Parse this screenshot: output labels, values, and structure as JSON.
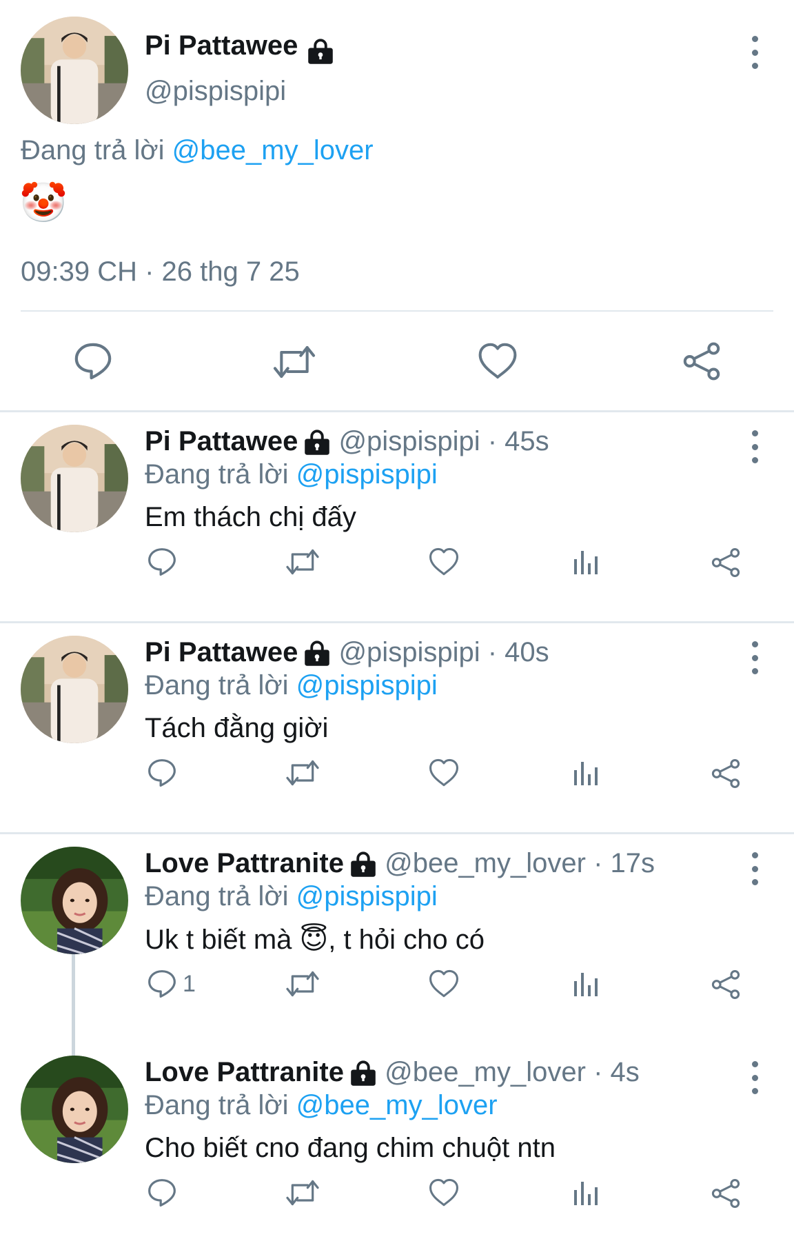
{
  "main_tweet": {
    "name": "Pi Pattawee",
    "handle": "@pispispipi",
    "replying_prefix": "Đang trả lời",
    "replying_to": "@bee_my_lover",
    "emoji": "🤡",
    "timestamp": "09:39 CH · 26 thg 7 25"
  },
  "replies": [
    {
      "name": "Pi Pattawee",
      "meta": "@pispispipi · 45s",
      "replying_prefix": "Đang trả lời",
      "replying_to": "@pispispipi",
      "text": "Em thách chị đấy",
      "reply_count": ""
    },
    {
      "name": "Pi Pattawee",
      "meta": "@pispispipi · 40s",
      "replying_prefix": "Đang trả lời",
      "replying_to": "@pispispipi",
      "text": "Tách đằng giời",
      "reply_count": ""
    },
    {
      "name": "Love Pattranite",
      "meta": "@bee_my_lover · 17s",
      "replying_prefix": "Đang trả lời",
      "replying_to": "@pispispipi",
      "text_before": "Uk t biết mà ",
      "emoji": "😇",
      "text_after": ", t hỏi cho có",
      "reply_count": "1"
    },
    {
      "name": "Love Pattranite",
      "meta": "@bee_my_lover · 4s",
      "replying_prefix": "Đang trả lời",
      "replying_to": "@bee_my_lover",
      "text": "Cho biết cno đang chim chuột ntn",
      "reply_count": ""
    }
  ],
  "colors": {
    "accent": "#1da1f2",
    "muted": "#657786",
    "divider": "#e1e8ed"
  },
  "icons": [
    "lock-icon",
    "more-icon",
    "reply-icon",
    "retweet-icon",
    "like-icon",
    "analytics-icon",
    "share-icon"
  ]
}
